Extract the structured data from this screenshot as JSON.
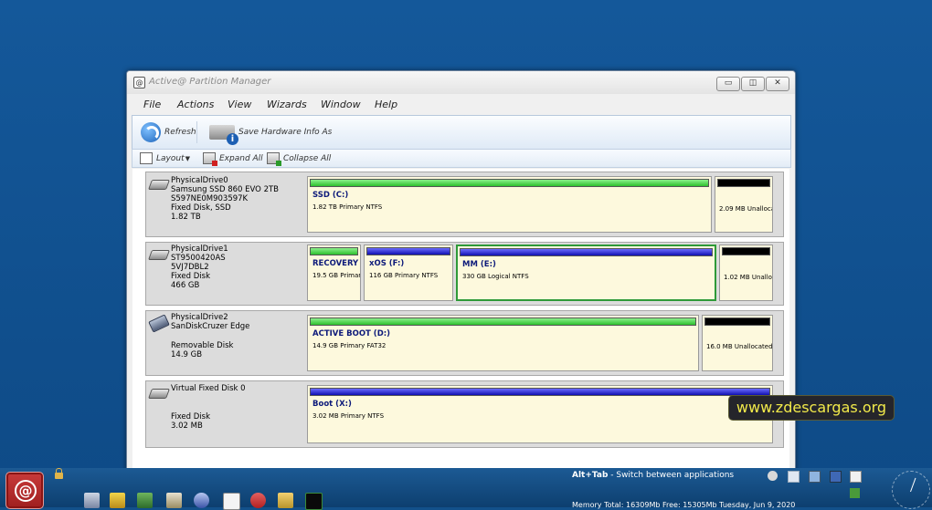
{
  "window": {
    "title": "Active@ Partition Manager",
    "minimize": "▭",
    "maximize": "◫",
    "close": "✕"
  },
  "menu": [
    "File",
    "Actions",
    "View",
    "Wizards",
    "Window",
    "Help"
  ],
  "toolbar": {
    "refresh": "Refresh",
    "save_hw": "Save Hardware Info As"
  },
  "toolbar2": {
    "layout": "Layout",
    "expand_all": "Expand All",
    "collapse_all": "Collapse All"
  },
  "drives": [
    {
      "lines": [
        "PhysicalDrive0",
        "Samsung SSD 860 EVO 2TB",
        "S597NE0M903597K",
        "Fixed Disk, SSD",
        "1.82 TB"
      ],
      "partitions": [
        {
          "name": "SSD (C:)",
          "desc": "1.82 TB Primary NTFS",
          "bar": "ntfs"
        },
        {
          "name": "",
          "desc": "2.09 MB Unalloca",
          "bar": "unalloc"
        }
      ]
    },
    {
      "lines": [
        "PhysicalDrive1",
        "ST9500420AS",
        "5VJ7DBL2",
        "Fixed Disk",
        "466 GB"
      ],
      "partitions": [
        {
          "name": "RECOVERY (",
          "desc": "19.5 GB Primary",
          "bar": "ntfs"
        },
        {
          "name": "xOS (F:)",
          "desc": "116 GB Primary NTFS",
          "bar": "logical"
        },
        {
          "name": "MM (E:)",
          "desc": "330 GB Logical NTFS",
          "bar": "logical"
        },
        {
          "name": "",
          "desc": "1.02 MB Unallo",
          "bar": "unalloc"
        }
      ]
    },
    {
      "lines": [
        "PhysicalDrive2",
        "SanDiskCruzer Edge",
        "",
        "Removable Disk",
        "14.9 GB"
      ],
      "partitions": [
        {
          "name": "ACTIVE BOOT (D:)",
          "desc": "14.9 GB Primary FAT32",
          "bar": "fat"
        },
        {
          "name": "",
          "desc": "16.0 MB Unallocated",
          "bar": "unalloc"
        }
      ]
    },
    {
      "lines": [
        "Virtual Fixed Disk 0",
        "",
        "",
        "Fixed Disk",
        "3.02 MB"
      ],
      "partitions": [
        {
          "name": "Boot (X:)",
          "desc": "3.02 MB Primary NTFS",
          "bar": "logical"
        }
      ]
    }
  ],
  "taskbar": {
    "alt_tab_key": "Alt+Tab",
    "alt_tab_text": " - Switch between applications",
    "memory": "Memory Total: 16309Mb Free: 15305Mb  Tuesday, Jun 9, 2020"
  },
  "watermark": "www.zdescargas.org"
}
